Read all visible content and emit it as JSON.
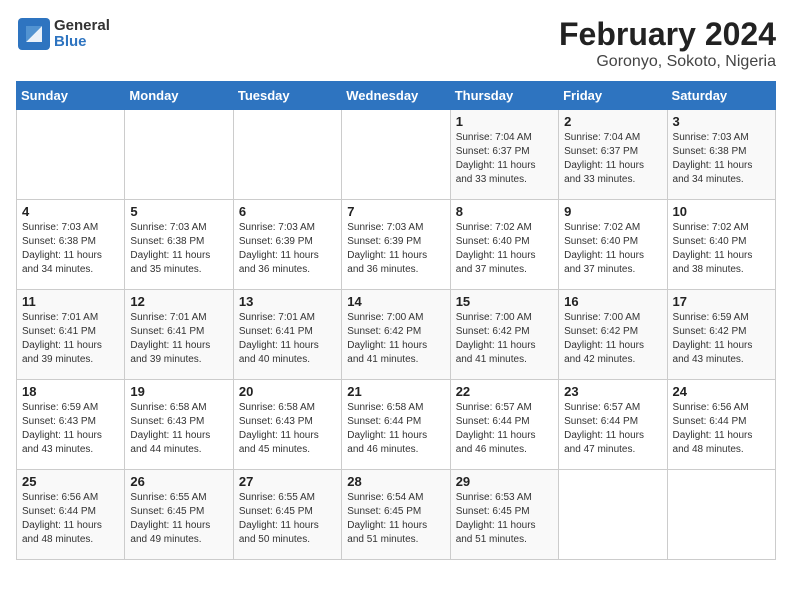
{
  "logo": {
    "line1": "General",
    "line2": "Blue"
  },
  "title": "February 2024",
  "subtitle": "Goronyo, Sokoto, Nigeria",
  "days_of_week": [
    "Sunday",
    "Monday",
    "Tuesday",
    "Wednesday",
    "Thursday",
    "Friday",
    "Saturday"
  ],
  "weeks": [
    [
      {
        "day": "",
        "info": ""
      },
      {
        "day": "",
        "info": ""
      },
      {
        "day": "",
        "info": ""
      },
      {
        "day": "",
        "info": ""
      },
      {
        "day": "1",
        "info": "Sunrise: 7:04 AM\nSunset: 6:37 PM\nDaylight: 11 hours\nand 33 minutes."
      },
      {
        "day": "2",
        "info": "Sunrise: 7:04 AM\nSunset: 6:37 PM\nDaylight: 11 hours\nand 33 minutes."
      },
      {
        "day": "3",
        "info": "Sunrise: 7:03 AM\nSunset: 6:38 PM\nDaylight: 11 hours\nand 34 minutes."
      }
    ],
    [
      {
        "day": "4",
        "info": "Sunrise: 7:03 AM\nSunset: 6:38 PM\nDaylight: 11 hours\nand 34 minutes."
      },
      {
        "day": "5",
        "info": "Sunrise: 7:03 AM\nSunset: 6:38 PM\nDaylight: 11 hours\nand 35 minutes."
      },
      {
        "day": "6",
        "info": "Sunrise: 7:03 AM\nSunset: 6:39 PM\nDaylight: 11 hours\nand 36 minutes."
      },
      {
        "day": "7",
        "info": "Sunrise: 7:03 AM\nSunset: 6:39 PM\nDaylight: 11 hours\nand 36 minutes."
      },
      {
        "day": "8",
        "info": "Sunrise: 7:02 AM\nSunset: 6:40 PM\nDaylight: 11 hours\nand 37 minutes."
      },
      {
        "day": "9",
        "info": "Sunrise: 7:02 AM\nSunset: 6:40 PM\nDaylight: 11 hours\nand 37 minutes."
      },
      {
        "day": "10",
        "info": "Sunrise: 7:02 AM\nSunset: 6:40 PM\nDaylight: 11 hours\nand 38 minutes."
      }
    ],
    [
      {
        "day": "11",
        "info": "Sunrise: 7:01 AM\nSunset: 6:41 PM\nDaylight: 11 hours\nand 39 minutes."
      },
      {
        "day": "12",
        "info": "Sunrise: 7:01 AM\nSunset: 6:41 PM\nDaylight: 11 hours\nand 39 minutes."
      },
      {
        "day": "13",
        "info": "Sunrise: 7:01 AM\nSunset: 6:41 PM\nDaylight: 11 hours\nand 40 minutes."
      },
      {
        "day": "14",
        "info": "Sunrise: 7:00 AM\nSunset: 6:42 PM\nDaylight: 11 hours\nand 41 minutes."
      },
      {
        "day": "15",
        "info": "Sunrise: 7:00 AM\nSunset: 6:42 PM\nDaylight: 11 hours\nand 41 minutes."
      },
      {
        "day": "16",
        "info": "Sunrise: 7:00 AM\nSunset: 6:42 PM\nDaylight: 11 hours\nand 42 minutes."
      },
      {
        "day": "17",
        "info": "Sunrise: 6:59 AM\nSunset: 6:42 PM\nDaylight: 11 hours\nand 43 minutes."
      }
    ],
    [
      {
        "day": "18",
        "info": "Sunrise: 6:59 AM\nSunset: 6:43 PM\nDaylight: 11 hours\nand 43 minutes."
      },
      {
        "day": "19",
        "info": "Sunrise: 6:58 AM\nSunset: 6:43 PM\nDaylight: 11 hours\nand 44 minutes."
      },
      {
        "day": "20",
        "info": "Sunrise: 6:58 AM\nSunset: 6:43 PM\nDaylight: 11 hours\nand 45 minutes."
      },
      {
        "day": "21",
        "info": "Sunrise: 6:58 AM\nSunset: 6:44 PM\nDaylight: 11 hours\nand 46 minutes."
      },
      {
        "day": "22",
        "info": "Sunrise: 6:57 AM\nSunset: 6:44 PM\nDaylight: 11 hours\nand 46 minutes."
      },
      {
        "day": "23",
        "info": "Sunrise: 6:57 AM\nSunset: 6:44 PM\nDaylight: 11 hours\nand 47 minutes."
      },
      {
        "day": "24",
        "info": "Sunrise: 6:56 AM\nSunset: 6:44 PM\nDaylight: 11 hours\nand 48 minutes."
      }
    ],
    [
      {
        "day": "25",
        "info": "Sunrise: 6:56 AM\nSunset: 6:44 PM\nDaylight: 11 hours\nand 48 minutes."
      },
      {
        "day": "26",
        "info": "Sunrise: 6:55 AM\nSunset: 6:45 PM\nDaylight: 11 hours\nand 49 minutes."
      },
      {
        "day": "27",
        "info": "Sunrise: 6:55 AM\nSunset: 6:45 PM\nDaylight: 11 hours\nand 50 minutes."
      },
      {
        "day": "28",
        "info": "Sunrise: 6:54 AM\nSunset: 6:45 PM\nDaylight: 11 hours\nand 51 minutes."
      },
      {
        "day": "29",
        "info": "Sunrise: 6:53 AM\nSunset: 6:45 PM\nDaylight: 11 hours\nand 51 minutes."
      },
      {
        "day": "",
        "info": ""
      },
      {
        "day": "",
        "info": ""
      }
    ]
  ]
}
